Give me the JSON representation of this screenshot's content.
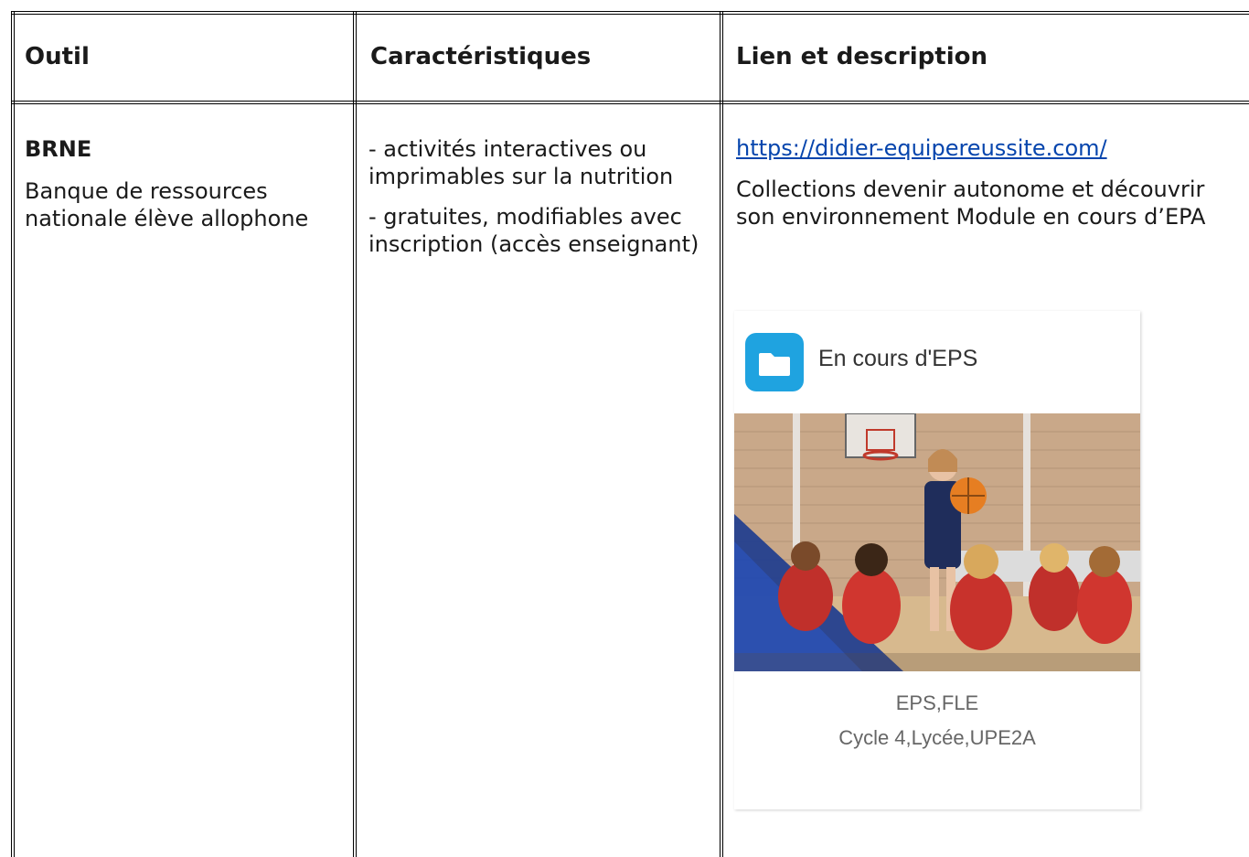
{
  "headers": [
    "Outil",
    "Caractéristiques",
    "Lien et description"
  ],
  "row": {
    "outil": {
      "name": "BRNE",
      "description": "Banque de ressources nationale élève allophone"
    },
    "caracteristiques": [
      "- activités interactives ou imprimables sur la nutrition",
      "- gratuites, modifiables avec inscription (accès enseignant)"
    ],
    "lien": {
      "url": "https://didier-equipereussite.com/",
      "description": "Collections devenir autonome et découvrir son environnement Module en cours d’EPA"
    }
  },
  "card": {
    "icon": "folder-icon",
    "title": "En cours d'EPS",
    "subjects": "EPS,FLE",
    "levels": "Cycle 4,Lycée,UPE2A"
  },
  "colors": {
    "link": "#0645ad",
    "icon_bg": "#1fa3e0",
    "border": "#000000"
  }
}
